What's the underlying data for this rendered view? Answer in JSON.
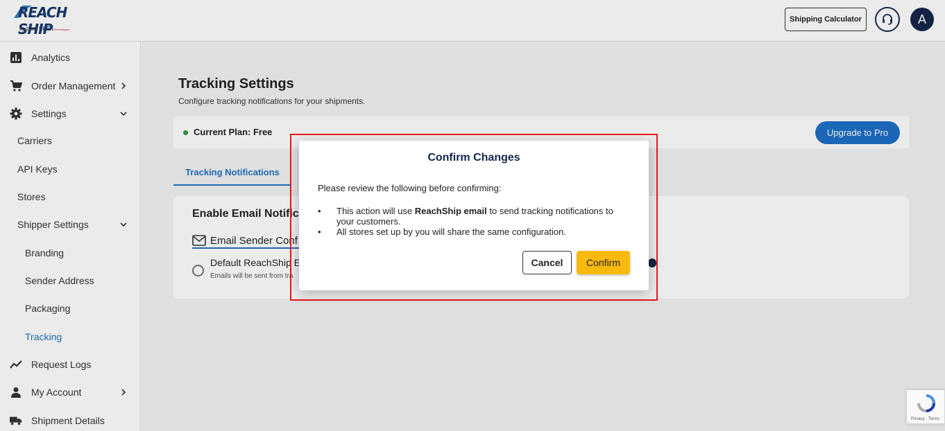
{
  "brand": {
    "name": "REACH SHIP",
    "by": "by Team",
    "org": "ELEX",
    "suffix": "Technologies"
  },
  "header": {
    "shipping_calculator": "Shipping Calculator",
    "avatar_initial": "A"
  },
  "sidebar": {
    "items": [
      {
        "label": "Analytics",
        "icon": "analytics-icon"
      },
      {
        "label": "Order Management",
        "icon": "cart-icon"
      },
      {
        "label": "Settings",
        "icon": "gear-icon"
      },
      {
        "label": "Carriers"
      },
      {
        "label": "API Keys"
      },
      {
        "label": "Stores"
      },
      {
        "label": "Shipper Settings"
      },
      {
        "label": "Branding"
      },
      {
        "label": "Sender Address"
      },
      {
        "label": "Packaging"
      },
      {
        "label": "Tracking"
      },
      {
        "label": "Request Logs",
        "icon": "trend-icon"
      },
      {
        "label": "My Account",
        "icon": "person-icon"
      },
      {
        "label": "Shipment Details",
        "icon": "truck-icon"
      }
    ],
    "active": "Tracking",
    "active_color": "#2272c3"
  },
  "page": {
    "title": "Tracking Settings",
    "subtitle": "Configure tracking notifications for your shipments.",
    "plan_label": "Current Plan: Free",
    "upgrade_label": "Upgrade to Pro",
    "tab_label": "Tracking Notifications",
    "card_title": "Enable Email Notific",
    "sender_label": "Email Sender Conf",
    "radio_label": "Default ReachShip Em",
    "radio_help": "Emails will be sent from tra"
  },
  "dialog": {
    "title": "Confirm Changes",
    "intro": "Please review the following before confirming:",
    "bullet1_pre": "This action will use ",
    "bullet1_bold": "ReachShip email",
    "bullet1_post": " to send tracking notifications to your customers.",
    "bullet2": "All stores set up by you will share the same configuration.",
    "cancel_label": "Cancel",
    "confirm_label": "Confirm"
  },
  "recaptcha": {
    "text": "Privacy - Terms"
  },
  "colors": {
    "accent": "#2272c3",
    "confirm": "#f9b90f",
    "highlight": "#e8191b",
    "navy": "#16264a"
  }
}
